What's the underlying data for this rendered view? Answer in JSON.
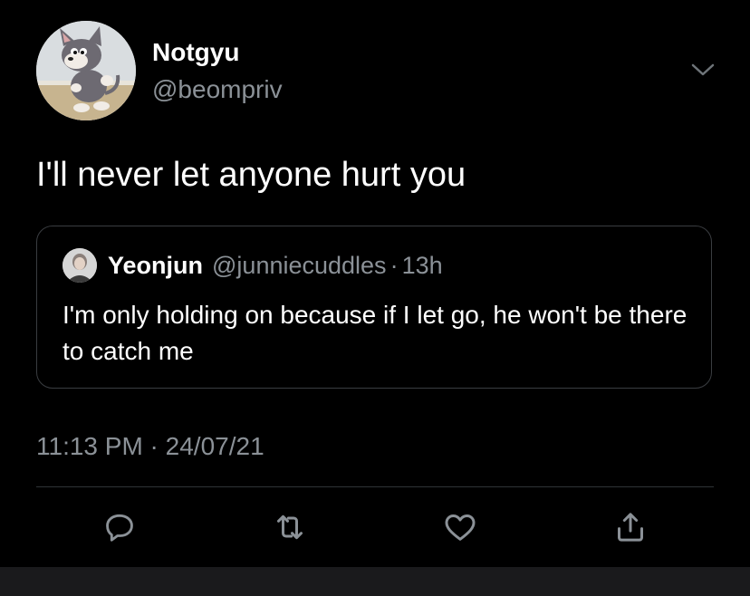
{
  "tweet": {
    "author": {
      "display_name": "Notgyu",
      "handle": "@beompriv",
      "avatar_icon": "cartoon-cat-avatar-icon"
    },
    "menu_icon": "chevron-down-icon",
    "text": "I'll never let anyone hurt you",
    "timestamp": "11:13 PM · 24/07/21"
  },
  "quoted_tweet": {
    "display_name": "Yeonjun",
    "handle": "@junniecuddles",
    "separator": "·",
    "time_ago": "13h",
    "text": "I'm only holding on because if I let go, he won't be there to catch me",
    "avatar_icon": "person-avatar-icon"
  },
  "actions": [
    {
      "name": "reply",
      "icon": "reply-icon"
    },
    {
      "name": "retweet",
      "icon": "retweet-icon"
    },
    {
      "name": "like",
      "icon": "heart-icon"
    },
    {
      "name": "share",
      "icon": "share-icon"
    }
  ],
  "colors": {
    "background": "#000000",
    "primary_text": "#ffffff",
    "secondary_text": "#8b9197",
    "border": "#3a3d41"
  }
}
